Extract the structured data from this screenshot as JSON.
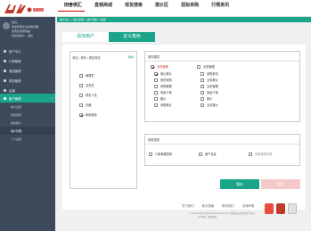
{
  "header": {
    "logo_text": "阿拉丁",
    "nav": [
      "田舍供汇",
      "直销商城",
      "现货搜索",
      "报价区",
      "招标采购",
      "行情资讯"
    ]
  },
  "sidebar": {
    "user_lines": [
      "您好，",
      "欢迎登录平台系统管理",
      "您现在登录的是",
      "供应商用户  ·  退出"
    ],
    "items": [
      {
        "label": "用户中心"
      },
      {
        "label": "订单管理"
      },
      {
        "label": "商品管理"
      },
      {
        "label": "财务管理"
      },
      {
        "label": "店铺"
      },
      {
        "label": "账户管理"
      }
    ],
    "subitems": [
      "用户设置",
      "修改密码",
      "我的账户",
      "用户管理",
      "个人设置"
    ]
  },
  "breadcrumb": "用户中心  >  账户管理  >  用户管理  >  权限",
  "tabs": {
    "add_user": "添加用户",
    "define_role": "定义角色"
  },
  "rolelist": {
    "header": "添加 / 修改 / 删除角色",
    "link": "删除",
    "roles": [
      {
        "label": "管理员",
        "checked": false
      },
      {
        "label": "业务员",
        "checked": false
      },
      {
        "label": "财务人员",
        "checked": false
      },
      {
        "label": "总裁",
        "checked": false
      },
      {
        "label": "新增角色",
        "checked": true
      }
    ]
  },
  "perm": {
    "title": "操作权限",
    "col1": [
      {
        "label": "业务管理",
        "checked": true,
        "red": true
      },
      {
        "label": "竞价报价",
        "checked": true
      },
      {
        "label": "现货采购",
        "checked": false
      },
      {
        "label": "采购管理",
        "checked": false
      },
      {
        "label": "商品下单",
        "checked": false
      },
      {
        "label": "报价",
        "checked": false
      },
      {
        "label": "采购报价",
        "checked": false
      }
    ],
    "col2": [
      {
        "label": "业务管理",
        "checked": false
      },
      {
        "label": "采购资讯",
        "checked": false
      },
      {
        "label": "业务报价",
        "checked": false
      },
      {
        "label": "业务管理",
        "checked": false
      },
      {
        "label": "商品下单",
        "checked": false
      },
      {
        "label": "报价",
        "checked": false
      },
      {
        "label": "业务报价",
        "checked": false
      }
    ]
  },
  "perm2": {
    "title": "查看权限",
    "items": [
      {
        "label": "订单管理查看",
        "checked": false
      },
      {
        "label": "用户信息",
        "checked": false
      },
      {
        "label": "查看管理权限",
        "checked": false,
        "grey": true
      }
    ]
  },
  "buttons": {
    "ok": "保存",
    "cancel": "取消"
  },
  "footer": {
    "links": [
      "关于我们",
      "新手指南",
      "联系我们",
      "法律声明"
    ],
    "copyright": "© 2015 阿拉丁网 All rights reserved  |  增值电信业务经营许可证",
    "icp": "沪ICP备  ·  增值服务"
  },
  "colors": {
    "accent": "#1aa58a",
    "sidebar": "#3d4a5c",
    "brand_red": "#c0392b"
  }
}
